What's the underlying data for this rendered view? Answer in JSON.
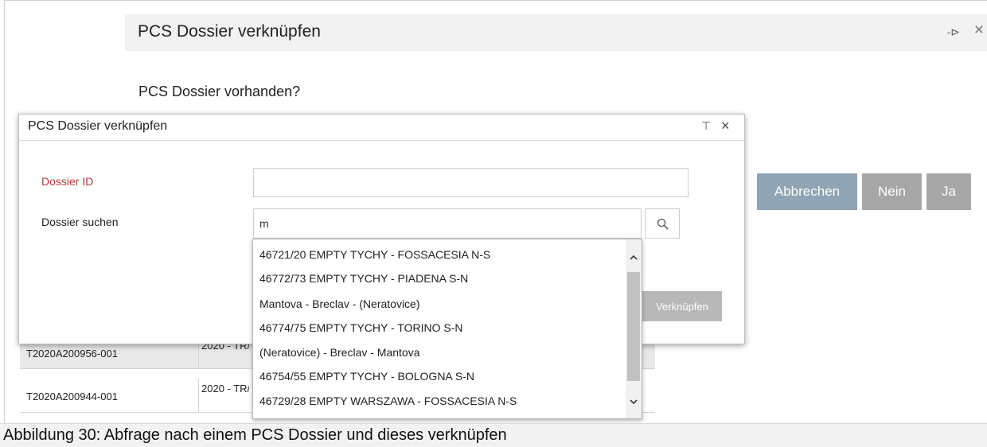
{
  "outer_dialog": {
    "title": "PCS Dossier verknüpfen",
    "question": "PCS Dossier vorhanden?",
    "buttons": {
      "cancel": "Abbrechen",
      "no": "Nein",
      "yes": "Ja"
    },
    "colors": {
      "cancel_button": "#90a4b3",
      "secondary_button": "#a7a7a7"
    }
  },
  "background_table": {
    "rows": [
      {
        "id": "T2020A200956-001",
        "date": "2020 - TR/2181"
      },
      {
        "id": "T2020A200944-001",
        "date": "2020 - TR/2181"
      }
    ]
  },
  "inner_dialog": {
    "title": "PCS Dossier verknüpfen",
    "dossier_id_label": "Dossier ID",
    "dossier_id_value": "",
    "dossier_search_label": "Dossier suchen",
    "dossier_search_value": "m",
    "link_button": "Verknüpfen",
    "colors": {
      "required_label": "#b23a3a"
    }
  },
  "dropdown": {
    "items": [
      "46721/20 EMPTY TYCHY - FOSSACESIA N-S",
      "46772/73 EMPTY TYCHY - PIADENA S-N",
      "Mantova - Breclav - (Neratovice)",
      "46774/75 EMPTY TYCHY - TORINO S-N",
      "(Neratovice) - Breclav - Mantova",
      "46754/55 EMPTY TYCHY - BOLOGNA S-N",
      "46729/28 EMPTY WARSZAWA - FOSSACESIA N-S"
    ]
  },
  "caption": "Abbildung 30: Abfrage nach einem PCS Dossier und dieses verknüpfen"
}
